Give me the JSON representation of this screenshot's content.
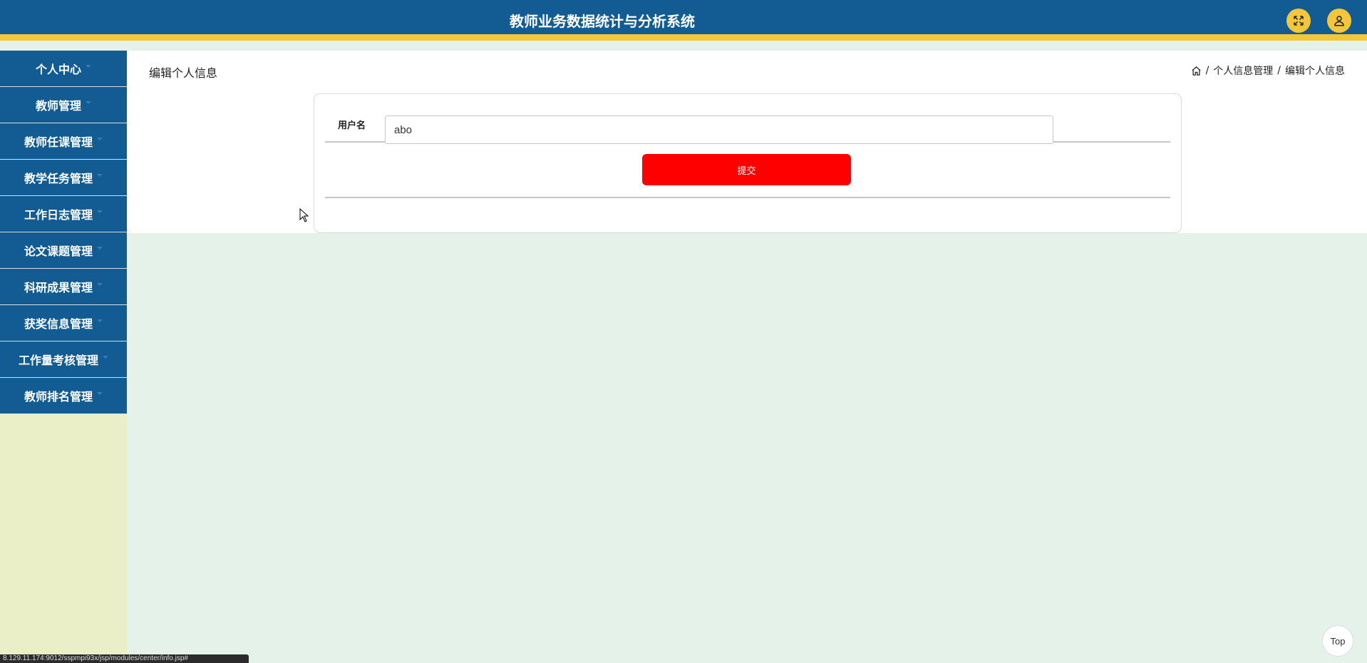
{
  "header": {
    "title": "教师业务数据统计与分析系统",
    "fullscreen_icon": "fullscreen-icon",
    "user_icon": "user-icon",
    "accent_color": "#f4c73a",
    "bg_color": "#135c93"
  },
  "sidebar": {
    "items": [
      {
        "label": "个人中心"
      },
      {
        "label": "教师管理"
      },
      {
        "label": "教师任课管理"
      },
      {
        "label": "教学任务管理"
      },
      {
        "label": "工作日志管理"
      },
      {
        "label": "论文课题管理"
      },
      {
        "label": "科研成果管理"
      },
      {
        "label": "获奖信息管理"
      },
      {
        "label": "工作量考核管理"
      },
      {
        "label": "教师排名管理"
      }
    ]
  },
  "main": {
    "page_title": "编辑个人信息",
    "breadcrumb": {
      "separator": "/",
      "items": [
        "个人信息管理",
        "编辑个人信息"
      ]
    },
    "form": {
      "username_label": "用户名",
      "username_value": "abo",
      "submit_label": "提交",
      "submit_color": "#ff0000"
    }
  },
  "top_button": {
    "label": "Top"
  },
  "status_bar": {
    "url": "8.129.11.174:9012/sspmpi93x/jsp/modules/center/info.jsp#"
  }
}
